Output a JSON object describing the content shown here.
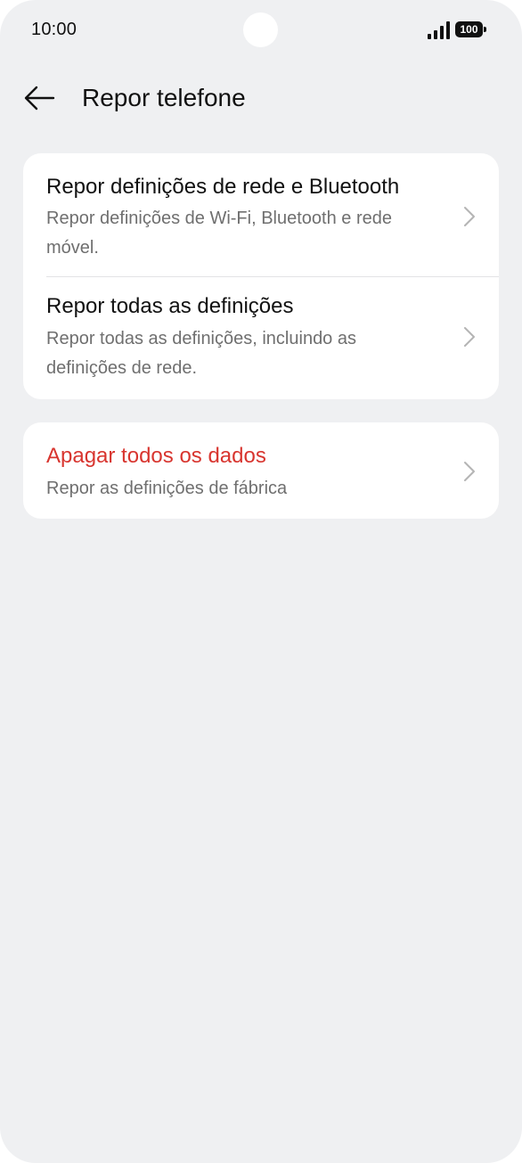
{
  "status_bar": {
    "time": "10:00",
    "battery_level": "100"
  },
  "header": {
    "title": "Repor telefone"
  },
  "settings": {
    "network_reset": {
      "title": "Repor definições de rede e Bluetooth",
      "subtitle": "Repor definições de Wi-Fi, Bluetooth e rede móvel."
    },
    "reset_all": {
      "title": "Repor todas as definições",
      "subtitle": "Repor todas as definições, incluindo as definições de rede."
    },
    "erase_all": {
      "title": "Apagar todos os dados",
      "subtitle": "Repor as definições de fábrica"
    }
  },
  "colors": {
    "background": "#eff0f2",
    "card": "#ffffff",
    "danger": "#d8352f",
    "subtitle": "#6f6f6f"
  }
}
